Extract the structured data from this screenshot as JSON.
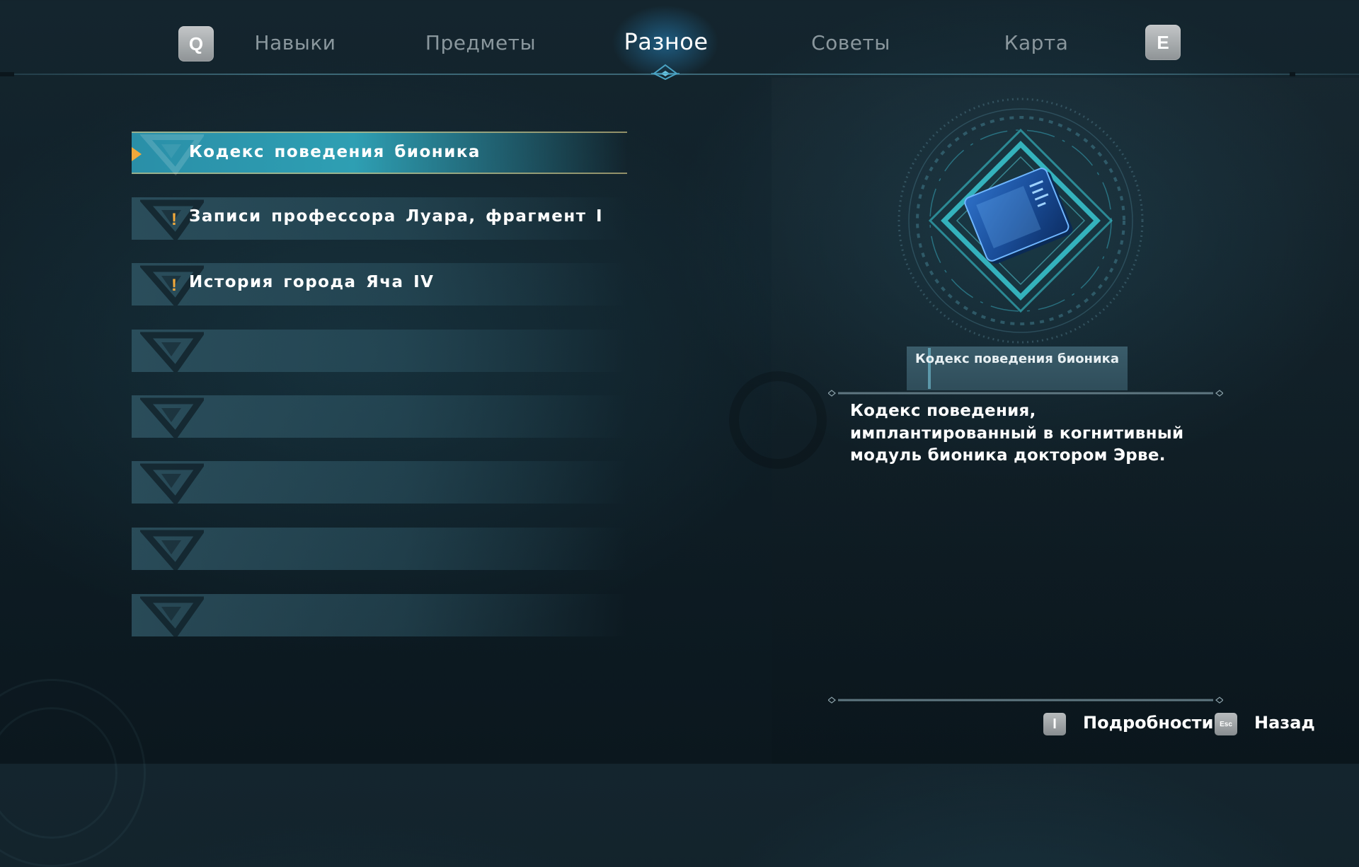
{
  "tabs": {
    "prev_key": "Q",
    "next_key": "E",
    "items": [
      {
        "label": "Навыки",
        "active": false
      },
      {
        "label": "Предметы",
        "active": false
      },
      {
        "label": "Разное",
        "active": true
      },
      {
        "label": "Советы",
        "active": false
      },
      {
        "label": "Карта",
        "active": false
      }
    ]
  },
  "list": {
    "items": [
      {
        "label": "Кодекс поведения бионика",
        "selected": true,
        "new": false
      },
      {
        "label": "Записи профессора Луара, фрагмент I",
        "selected": false,
        "new": true,
        "new_mark": "!"
      },
      {
        "label": "История города Яча IV",
        "selected": false,
        "new": true,
        "new_mark": "!"
      },
      {
        "label": "",
        "selected": false,
        "new": false
      },
      {
        "label": "",
        "selected": false,
        "new": false
      },
      {
        "label": "",
        "selected": false,
        "new": false
      },
      {
        "label": "",
        "selected": false,
        "new": false
      },
      {
        "label": "",
        "selected": false,
        "new": false
      }
    ]
  },
  "details": {
    "item_name": "Кодекс поведения бионика",
    "description": "Кодекс поведения, имплантированный в когнитивный модуль бионика доктором Эрве.",
    "icon": "datapad-icon"
  },
  "hints": {
    "details_key": "I",
    "details_label": "Подробности",
    "back_key": "Esc",
    "back_label": "Назад"
  },
  "colors": {
    "accent": "#2e9fb3",
    "new_mark": "#f2a93b",
    "tab_inactive": "#8a979d"
  }
}
